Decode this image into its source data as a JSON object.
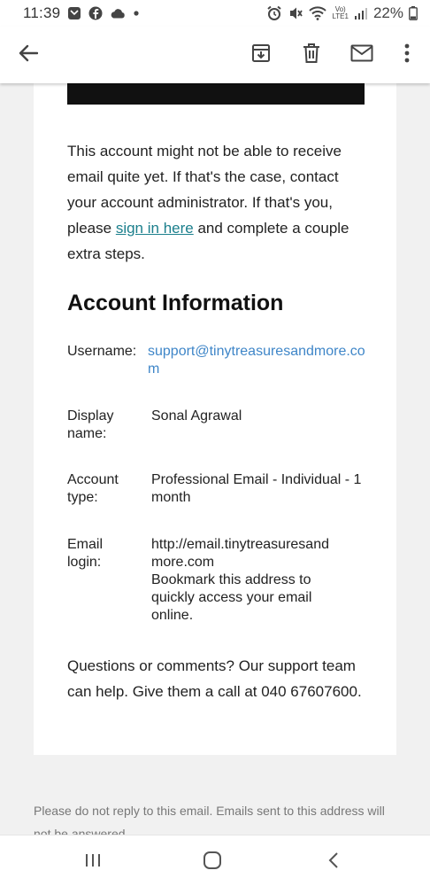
{
  "status_bar": {
    "time": "11:39",
    "battery": "22%",
    "volte_top": "Vo)",
    "volte_bottom": "LTE1"
  },
  "app_bar": {
    "icons": [
      "back-arrow-icon",
      "archive-icon",
      "delete-icon",
      "mark-unread-icon",
      "more-vert-icon"
    ]
  },
  "email": {
    "paragraph": {
      "before_link": "This account might not be able to receive email quite yet. If that's the case, contact your account administrator. If that's you, please ",
      "link": "sign in here",
      "after_link": " and complete a couple extra steps."
    },
    "heading": "Account Information",
    "username_label": "Username:",
    "username_value": "support@tinytreasuresandmore.com",
    "display_name_label": "Display name:",
    "display_name_value": "Sonal Agrawal",
    "account_type_label": "Account type:",
    "account_type_value": "Professional Email - Individual - 1 month",
    "email_login_label": "Email login:",
    "email_login_url": "http://email.tinytreasuresandmore.com",
    "email_login_note": "Bookmark this address to quickly access your email online.",
    "support_text": "Questions or comments? Our support team can help. Give them a call at 040 67607600.",
    "footer": "Please do not reply to this email. Emails sent to this address will not be answered."
  },
  "colors": {
    "link": "#1b7f8c",
    "value_link": "#3f86c8",
    "background": "#f1f1f1"
  }
}
